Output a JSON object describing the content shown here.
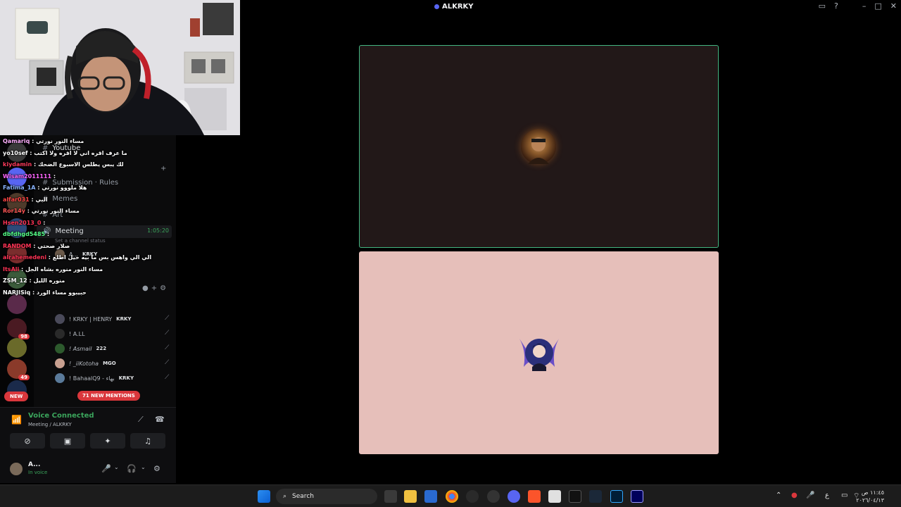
{
  "window": {
    "title": "ALKRKY"
  },
  "server": {
    "channels": [
      {
        "label": "Youtube",
        "type": "text"
      },
      {
        "label": "Submission · Rules",
        "type": "text"
      },
      {
        "label": "Memes",
        "type": "text"
      },
      {
        "label": "Art",
        "type": "text"
      },
      {
        "label": "Meeting",
        "type": "voice"
      }
    ],
    "meeting_timer": "1:05:20",
    "channel_status_placeholder": "Set a channel status",
    "voice_members": [
      {
        "name": "A...",
        "tag": "KRKY"
      },
      {
        "name": "! KRKY | HENRY",
        "tag": "KRKY"
      },
      {
        "name": "! A.LL",
        "tag": ""
      },
      {
        "name": "! Asmail",
        "tag": "222"
      },
      {
        "name": "! _iiKotoha",
        "tag": "MGO"
      },
      {
        "name": "! BahaalQ9 - بهاء",
        "tag": "KRKY"
      }
    ],
    "mentions_pill": "71 NEW MENTIONS",
    "guild_badges": [
      "98",
      "49",
      "NEW"
    ]
  },
  "voice_panel": {
    "status": "Voice Connected",
    "location": "Meeting / ALKRKY",
    "user_name": "A...",
    "user_status": "In voice"
  },
  "stream_chat": [
    {
      "user": "Qamariq",
      "color": "#ffb0ff",
      "message": "مساء النور نورتي"
    },
    {
      "user": "yo10sef",
      "color": "#ffffff",
      "message": "ما عرف اقره اني لا اقره ولا اكتب"
    },
    {
      "user": "kiydamin",
      "color": "#ff3b5c",
      "message": "لك يبس يطلس الاسبوع الضحك"
    },
    {
      "user": "Wisam2011111",
      "color": "#ff66ff",
      "message": ""
    },
    {
      "user": "Fatima_1A",
      "color": "#8ab4ff",
      "message": "هلا ملووو نورتي"
    },
    {
      "user": "alfar031",
      "color": "#ff4444",
      "message": "البي"
    },
    {
      "user": "Ror14y",
      "color": "#ff5555",
      "message": "مساء النور نورتي"
    },
    {
      "user": "Hsen2013_0",
      "color": "#ff3355",
      "message": ""
    },
    {
      "user": "dbfdhgd5485",
      "color": "#55ff88",
      "message": ""
    },
    {
      "user": "RANDOM",
      "color": "#ff3355",
      "message": "صلار صحتي"
    },
    {
      "user": "alrahemedeni",
      "color": "#ff3355",
      "message": "الي الي واهس بس ما بيه حيل اطلع"
    },
    {
      "user": "ItsAli",
      "color": "#ff3355",
      "message": "مساء النور منوره بشاه الجل"
    },
    {
      "user": "ZSM_12",
      "color": "#ffffff",
      "message": "منوره الليل"
    },
    {
      "user": "NARJISiq",
      "color": "#ffffff",
      "message": "حبيبوو مساء الورد"
    }
  ],
  "taskbar": {
    "search_label": "Search",
    "lang": "ع",
    "time": "١١:٤٥ ص",
    "date": "٢٠٢٦/٠٤/١٣"
  },
  "colors": {
    "speaking_border": "#43b581",
    "tile1_bg": "#221818",
    "tile2_bg": "#e6bfba",
    "danger": "#da373c",
    "online": "#3ba55c"
  }
}
